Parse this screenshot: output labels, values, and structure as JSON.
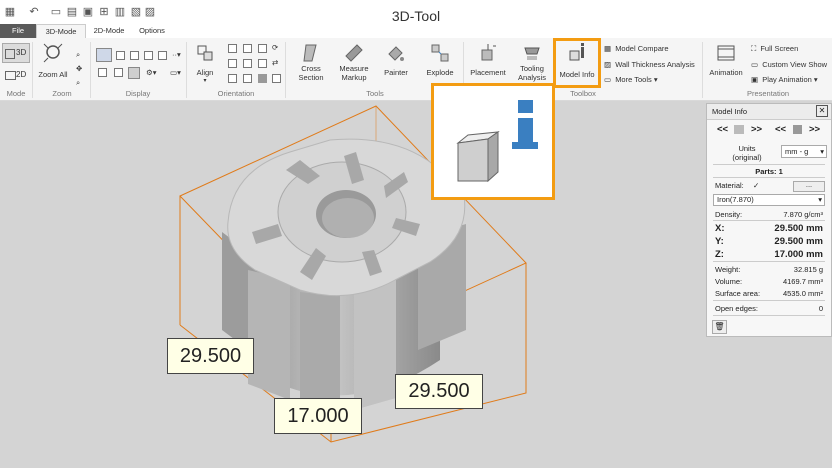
{
  "window": {
    "title": "3D-Tool"
  },
  "tabs": [
    {
      "label": "File"
    },
    {
      "label": "3D-Mode"
    },
    {
      "label": "2D-Mode"
    },
    {
      "label": "Options"
    }
  ],
  "ribbon": {
    "mode": {
      "btn3d": "3D",
      "btn2d": "2D",
      "group": "Mode"
    },
    "zoom": {
      "zoom_all": "Zoom All",
      "group": "Zoom"
    },
    "display": {
      "group": "Display"
    },
    "orientation": {
      "align": "Align",
      "group": "Orientation"
    },
    "tools": {
      "cross_section": [
        "Cross",
        "Section"
      ],
      "measure_markup": [
        "Measure",
        "Markup"
      ],
      "painter": "Painter",
      "explode": "Explode",
      "group": "Tools"
    },
    "toolbox": {
      "placement": "Placement",
      "tooling_analysis": [
        "Tooling",
        "Analysis"
      ],
      "model_info": "Model Info",
      "model_compare": "Model Compare",
      "wall_thickness": "Wall Thickness Analysis",
      "more_tools": "More Tools",
      "group": "Toolbox"
    },
    "presentation": {
      "animation": "Animation",
      "full_screen": "Full Screen",
      "custom_view_show": "Custom View Show",
      "play_animation": "Play Animation",
      "group": "Presentation"
    }
  },
  "viewport": {
    "dims": {
      "left": "29.500",
      "right": "29.500",
      "height": "17.000"
    }
  },
  "panel": {
    "title": "Model Info",
    "close": "✕",
    "nav": {
      "prev": "<<",
      "next": ">>"
    },
    "units_label": "Units (original)",
    "units_value": "mm - g",
    "parts": "Parts: 1",
    "material_label": "Material:",
    "material_check": "✓",
    "material_btn": "...",
    "material_value": "Iron(7.870)",
    "density_label": "Density:",
    "density_value": "7.870 g/cm³",
    "x_label": "X:",
    "x_value": "29.500 mm",
    "y_label": "Y:",
    "y_value": "29.500 mm",
    "z_label": "Z:",
    "z_value": "17.000 mm",
    "weight_label": "Weight:",
    "weight_value": "32.815 g",
    "volume_label": "Volume:",
    "volume_value": "4169.7 mm³",
    "surface_label": "Surface area:",
    "surface_value": "4535.0 mm²",
    "open_edges_label": "Open edges:",
    "open_edges_value": "0"
  },
  "colors": {
    "highlight": "#f39c12",
    "info_blue": "#3a7fc1",
    "bbox": "#e07b1a"
  }
}
